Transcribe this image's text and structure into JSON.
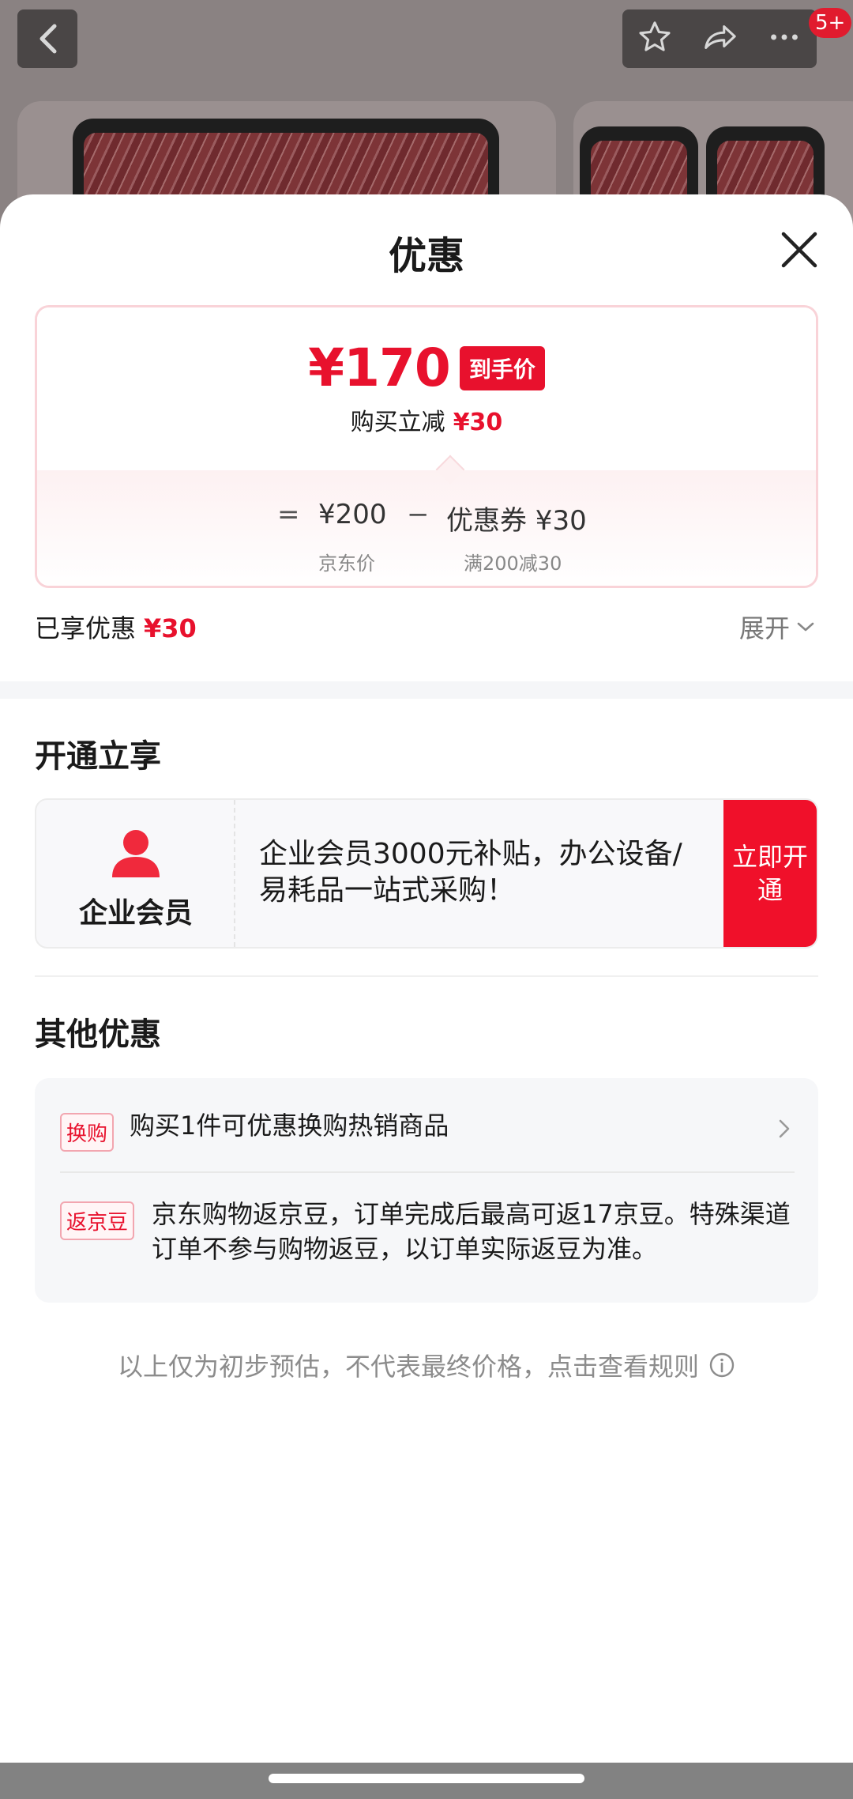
{
  "background": {
    "badge_count": "5+"
  },
  "sheet": {
    "title": "优惠"
  },
  "price_card": {
    "final_price": "¥170",
    "final_price_tag": "到手价",
    "instant_discount_label": "购买立减",
    "instant_discount_value": "¥30",
    "equals": "=",
    "jd_price": "¥200",
    "jd_price_label": "京东价",
    "minus": "−",
    "coupon": "优惠券 ¥30",
    "coupon_label": "满200减30"
  },
  "summary": {
    "enjoyed_label": "已享优惠",
    "enjoyed_value": "¥30",
    "expand_label": "展开"
  },
  "open_section": {
    "title": "开通立享",
    "member_name": "企业会员",
    "member_desc": "企业会员3000元补贴，办公设备/易耗品一站式采购！",
    "button_label": "立即开通"
  },
  "other_section": {
    "title": "其他优惠",
    "offers": [
      {
        "tag": "换购",
        "text": "购买1件可优惠换购热销商品"
      },
      {
        "tag": "返京豆",
        "text": "京东购物返京豆，订单完成后最高可返17京豆。特殊渠道订单不参与购物返豆，以订单实际返豆为准。"
      }
    ]
  },
  "disclaimer": "以上仅为初步预估，不代表最终价格，点击查看规则",
  "colors": {
    "accent_red": "#e8112d",
    "button_red": "#f0102a"
  },
  "icons": [
    "back-icon",
    "star-icon",
    "share-icon",
    "more-icon",
    "close-icon",
    "chevron-down-icon",
    "person-icon",
    "chevron-right-icon",
    "info-icon"
  ]
}
